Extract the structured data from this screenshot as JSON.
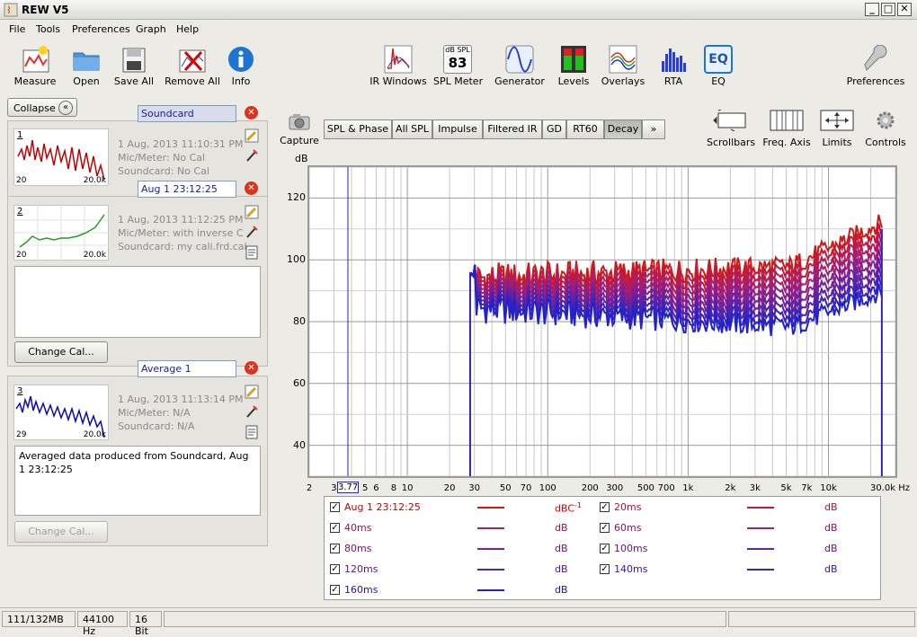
{
  "window": {
    "title": "REW V5"
  },
  "menu": [
    "File",
    "Tools",
    "Preferences",
    "Graph",
    "Help"
  ],
  "toolbar_left": [
    {
      "label": "Measure",
      "icon": "measure-icon"
    },
    {
      "label": "Open",
      "icon": "folder-icon"
    },
    {
      "label": "Save All",
      "icon": "save-icon"
    },
    {
      "label": "Remove All",
      "icon": "remove-all-icon"
    },
    {
      "label": "Info",
      "icon": "info-icon"
    }
  ],
  "toolbar_right": [
    {
      "label": "IR Windows",
      "icon": "ir-windows-icon"
    },
    {
      "label": "SPL Meter",
      "icon": "spl-meter-icon",
      "badge_top": "dB SPL",
      "badge_value": "83"
    },
    {
      "label": "Generator",
      "icon": "generator-icon"
    },
    {
      "label": "Levels",
      "icon": "levels-icon"
    },
    {
      "label": "Overlays",
      "icon": "overlays-icon"
    },
    {
      "label": "RTA",
      "icon": "rta-icon"
    },
    {
      "label": "EQ",
      "icon": "eq-icon",
      "badge_value": "EQ"
    }
  ],
  "preferences_label": "Preferences",
  "collapse_label": "Collapse",
  "measurements": [
    {
      "index": "1",
      "name": "Soundcard",
      "date": "1 Aug, 2013 11:10:31 PM",
      "mic": "Mic/Meter: No Cal",
      "soundcard": "Soundcard: No Cal",
      "xmin": "20",
      "xmax": "20.0k",
      "color": "#c00000"
    },
    {
      "index": "2",
      "name": "Aug 1 23:12:25",
      "date": "1 Aug, 2013 11:12:25 PM",
      "mic": "Mic/Meter: with inverse C",
      "soundcard": "Soundcard: my cali.frd.cal",
      "xmin": "20",
      "xmax": "20.0k",
      "color": "#2a9a2a",
      "notes": "",
      "button": "Change Cal..."
    },
    {
      "index": "3",
      "name": "Average 1",
      "date": "1 Aug, 2013 11:13:14 PM",
      "mic": "Mic/Meter: N/A",
      "soundcard": "Soundcard: N/A",
      "xmin": "29",
      "xmax": "20.0k",
      "color": "#0a0ab0",
      "notes": "Averaged data produced from Soundcard, Aug 1 23:12:25",
      "button": "Change Cal..."
    }
  ],
  "capture_label": "Capture",
  "tabs": [
    "SPL & Phase",
    "All SPL",
    "Impulse",
    "Filtered IR",
    "GD",
    "RT60",
    "Decay",
    "»"
  ],
  "selected_tab": "Decay",
  "graph_tools": [
    {
      "label": "Scrollbars",
      "icon": "scrollbars-icon"
    },
    {
      "label": "Freq. Axis",
      "icon": "freq-axis-icon"
    },
    {
      "label": "Limits",
      "icon": "limits-icon"
    },
    {
      "label": "Controls",
      "icon": "controls-icon"
    }
  ],
  "chart_data": {
    "type": "line",
    "ylabel": "dB",
    "xlabel": "Hz",
    "xscale": "log",
    "xlim": [
      2,
      30000
    ],
    "ylim": [
      30,
      130
    ],
    "yticks": [
      "40",
      "60",
      "80",
      "100",
      "120"
    ],
    "xticks": [
      "2",
      "3",
      "5",
      "6",
      "8",
      "10",
      "20",
      "30",
      "50",
      "70",
      "100",
      "200",
      "300",
      "500",
      "700",
      "1k",
      "2k",
      "3k",
      "5k",
      "7k",
      "10k",
      "30.0k Hz"
    ],
    "cursor_label": "3.77",
    "grid": true,
    "series": [
      {
        "name": "Aug 1 23:12:25",
        "color": "#d01818",
        "offset": 0
      },
      {
        "name": "20ms",
        "color": "#c01a3a",
        "offset": -2
      },
      {
        "name": "40ms",
        "color": "#b01c5a",
        "offset": -4
      },
      {
        "name": "60ms",
        "color": "#a01e78",
        "offset": -6
      },
      {
        "name": "80ms",
        "color": "#881e8c",
        "offset": -8
      },
      {
        "name": "100ms",
        "color": "#70209c",
        "offset": -10
      },
      {
        "name": "120ms",
        "color": "#5522aa",
        "offset": -12
      },
      {
        "name": "140ms",
        "color": "#3a24b8",
        "offset": -14
      },
      {
        "name": "160ms",
        "color": "#2222c8",
        "offset": -16
      }
    ]
  },
  "legend": [
    {
      "name": "Aug 1 23:12:25",
      "unit": "dBC",
      "sup": "-1",
      "color": "#d01818",
      "text_color": "#cc0000"
    },
    {
      "name": "20ms",
      "unit": "dB",
      "color": "#c01a3a",
      "text_color": "#b0103a"
    },
    {
      "name": "40ms",
      "unit": "dB",
      "color": "#b01c5a",
      "text_color": "#a01048"
    },
    {
      "name": "60ms",
      "unit": "dB",
      "color": "#a01e78",
      "text_color": "#901060"
    },
    {
      "name": "80ms",
      "unit": "dB",
      "color": "#881e8c",
      "text_color": "#801070"
    },
    {
      "name": "100ms",
      "unit": "dB",
      "color": "#70209c",
      "text_color": "#701080"
    },
    {
      "name": "120ms",
      "unit": "dB",
      "color": "#5522aa",
      "text_color": "#581090"
    },
    {
      "name": "140ms",
      "unit": "dB",
      "color": "#3a24b8",
      "text_color": "#4010a0"
    },
    {
      "name": "160ms",
      "unit": "dB",
      "color": "#2222c8",
      "text_color": "#2010b0"
    }
  ],
  "status": [
    "111/132MB",
    "44100 Hz",
    "16 Bit"
  ]
}
